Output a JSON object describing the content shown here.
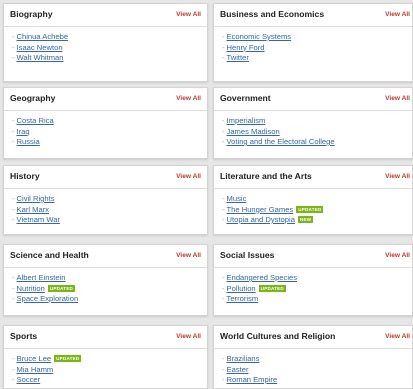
{
  "view_all_label": "View All",
  "badge_colors": {
    "updated": "#7cb518",
    "new": "#7cb518"
  },
  "cards": [
    {
      "title": "Biography",
      "links": [
        {
          "label": "Chinua Achebe",
          "badge": ""
        },
        {
          "label": "Isaac Newton",
          "badge": ""
        },
        {
          "label": "Walt Whitman",
          "badge": ""
        }
      ]
    },
    {
      "title": "Business and Economics",
      "links": [
        {
          "label": "Economic Systems",
          "badge": ""
        },
        {
          "label": "Henry Ford",
          "badge": ""
        },
        {
          "label": "Twitter",
          "badge": ""
        }
      ]
    },
    {
      "title": "Geography",
      "links": [
        {
          "label": "Costa Rica",
          "badge": ""
        },
        {
          "label": "Iraq",
          "badge": ""
        },
        {
          "label": "Russia",
          "badge": ""
        }
      ]
    },
    {
      "title": "Government",
      "links": [
        {
          "label": "Imperialism",
          "badge": ""
        },
        {
          "label": "James Madison",
          "badge": ""
        },
        {
          "label": "Voting and the Electoral College",
          "badge": ""
        }
      ]
    },
    {
      "title": "History",
      "links": [
        {
          "label": "Civil Rights",
          "badge": ""
        },
        {
          "label": "Karl Marx",
          "badge": ""
        },
        {
          "label": "Vietnam War",
          "badge": ""
        }
      ]
    },
    {
      "title": "Literature and the Arts",
      "links": [
        {
          "label": "Music",
          "badge": ""
        },
        {
          "label": "The Hunger Games",
          "badge": "UPDATED"
        },
        {
          "label": "Utopia and Dystopia",
          "badge": "NEW"
        }
      ]
    },
    {
      "title": "Science and Health",
      "links": [
        {
          "label": "Albert Einstein",
          "badge": ""
        },
        {
          "label": "Nutrition",
          "badge": "UPDATED"
        },
        {
          "label": "Space Exploration",
          "badge": ""
        }
      ]
    },
    {
      "title": "Social Issues",
      "links": [
        {
          "label": "Endangered Species",
          "badge": ""
        },
        {
          "label": "Pollution",
          "badge": "UPDATED"
        },
        {
          "label": "Terrorism",
          "badge": ""
        }
      ]
    },
    {
      "title": "Sports",
      "links": [
        {
          "label": "Bruce Lee",
          "badge": "UPDATED"
        },
        {
          "label": "Mia Hamm",
          "badge": ""
        },
        {
          "label": "Soccer",
          "badge": ""
        }
      ]
    },
    {
      "title": "World Cultures and Religion",
      "links": [
        {
          "label": "Brazilians",
          "badge": ""
        },
        {
          "label": "Easter",
          "badge": ""
        },
        {
          "label": "Roman Empire",
          "badge": ""
        }
      ]
    }
  ]
}
